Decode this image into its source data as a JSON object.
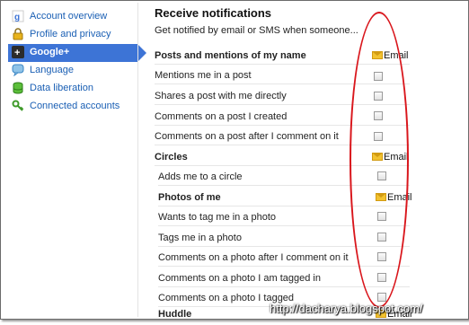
{
  "sidebar": {
    "items": [
      {
        "label": "Account overview",
        "icon": "google-icon",
        "active": false
      },
      {
        "label": "Profile and privacy",
        "icon": "lock-icon",
        "active": false
      },
      {
        "label": "Google+",
        "icon": "google-plus-icon",
        "active": true
      },
      {
        "label": "Language",
        "icon": "speech-bubble-icon",
        "active": false
      },
      {
        "label": "Data liberation",
        "icon": "database-icon",
        "active": false
      },
      {
        "label": "Connected accounts",
        "icon": "key-icon",
        "active": false
      }
    ]
  },
  "main": {
    "title": "Receive notifications",
    "subtitle": "Get notified by email or SMS when someone...",
    "email_label": "Email",
    "sections": [
      {
        "header": "Posts and mentions of my name",
        "items": [
          "Mentions me in a post",
          "Shares a post with me directly",
          "Comments on a post I created",
          "Comments on a post after I comment on it"
        ]
      },
      {
        "header": "Circles",
        "items": [
          "Adds me to a circle"
        ]
      },
      {
        "header": "Photos of me",
        "items": [
          "Wants to tag me in a photo",
          "Tags me in a photo",
          "Comments on a photo after I comment on it",
          "Comments on a photo I am tagged in",
          "Comments on a photo I tagged"
        ]
      },
      {
        "header": "Huddle",
        "items": []
      }
    ]
  },
  "watermark": "http://dacharya.blogspot.com/",
  "colors": {
    "accent": "#3d74d6",
    "annotation": "#d9161c",
    "link": "#1a5fb4"
  }
}
